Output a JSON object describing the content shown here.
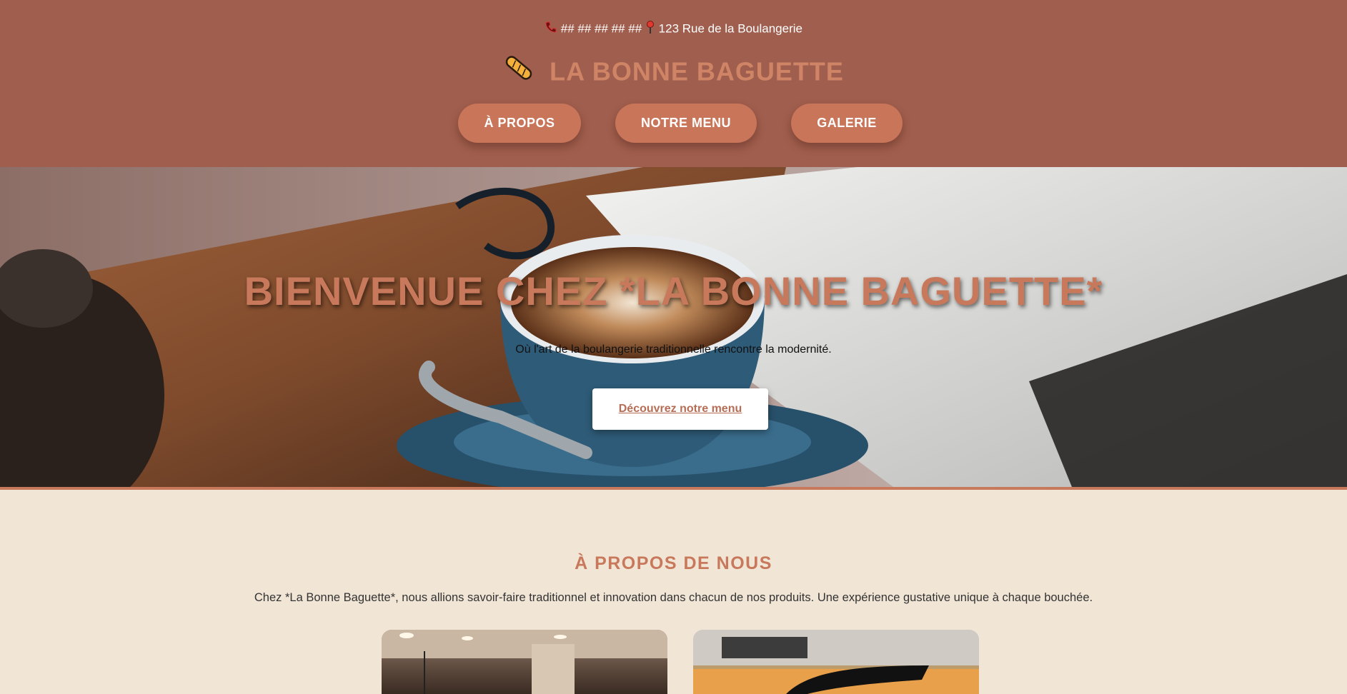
{
  "contact": {
    "phone": "## ## ## ## ##",
    "address": "123 Rue de la Boulangerie",
    "phone_icon": "phone-icon",
    "pin_icon": "pin-icon"
  },
  "brand": {
    "name": "LA BONNE BAGUETTE",
    "icon": "baguette-icon"
  },
  "nav": {
    "items": [
      {
        "label": "À PROPOS"
      },
      {
        "label": "NOTRE MENU"
      },
      {
        "label": "GALERIE"
      }
    ]
  },
  "hero": {
    "title": "BIENVENUE CHEZ *LA BONNE BAGUETTE*",
    "subtitle": "Où l'art de la boulangerie traditionnelle rencontre la modernité.",
    "cta_label": "Découvrez notre menu"
  },
  "about": {
    "title": "À PROPOS DE NOUS",
    "text": "Chez *La Bonne Baguette*, nous allions savoir-faire traditionnel et innovation dans chacun de nos produits. Une expérience gustative unique à chaque bouchée."
  },
  "colors": {
    "header_bg": "#a05e4e",
    "accent": "#c8785b",
    "page_bg": "#f1e5d6"
  }
}
